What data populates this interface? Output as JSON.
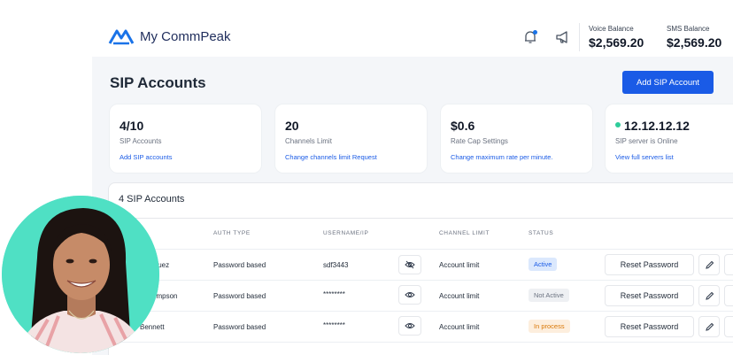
{
  "app": {
    "name": "My CommPeak"
  },
  "header": {
    "voice_balance_label": "Voice Balance",
    "voice_balance": "$2,569.20",
    "sms_balance_label": "SMS Balance",
    "sms_balance": "$2,569.20"
  },
  "page": {
    "title": "SIP Accounts",
    "add_button": "Add SIP Account"
  },
  "cards": [
    {
      "value": "4/10",
      "label": "SIP Accounts",
      "link": "Add SIP accounts"
    },
    {
      "value": "20",
      "label": "Channels Limit",
      "link": "Change channels limit Request"
    },
    {
      "value": "$0.6",
      "label": "Rate Cap Settings",
      "link": "Change maximum rate per minute."
    },
    {
      "value": "12.12.12.12",
      "label": "SIP server is Online",
      "link": "View full servers list"
    }
  ],
  "table": {
    "title": "4 SIP Accounts",
    "headers": {
      "auth": "AUTH TYPE",
      "user": "USERNAME/IP",
      "channel": "CHANNEL LIMIT",
      "status": "STATUS"
    },
    "rows": [
      {
        "name": "iguez",
        "auth": "Password based",
        "user": "sdf3443",
        "channel": "Account limit",
        "status": "Active",
        "action": "Reset Password"
      },
      {
        "name": "ompson",
        "auth": "Password based",
        "user": "********",
        "channel": "Account limit",
        "status": "Not Active",
        "action": "Reset Password"
      },
      {
        "name": "Bennett",
        "auth": "Password based",
        "user": "********",
        "channel": "Account limit",
        "status": "In process",
        "action": "Reset Password"
      }
    ]
  },
  "icons": {
    "logo": "commpeak-logo-icon",
    "bell": "bell-icon",
    "megaphone": "megaphone-icon",
    "eye_off": "eye-off-icon",
    "eye": "eye-icon",
    "edit": "pencil-icon",
    "delete": "trash-icon"
  },
  "colors": {
    "accent": "#1a5be6",
    "online": "#2ecc9a",
    "avatar_bg": "#4fe0c4"
  }
}
